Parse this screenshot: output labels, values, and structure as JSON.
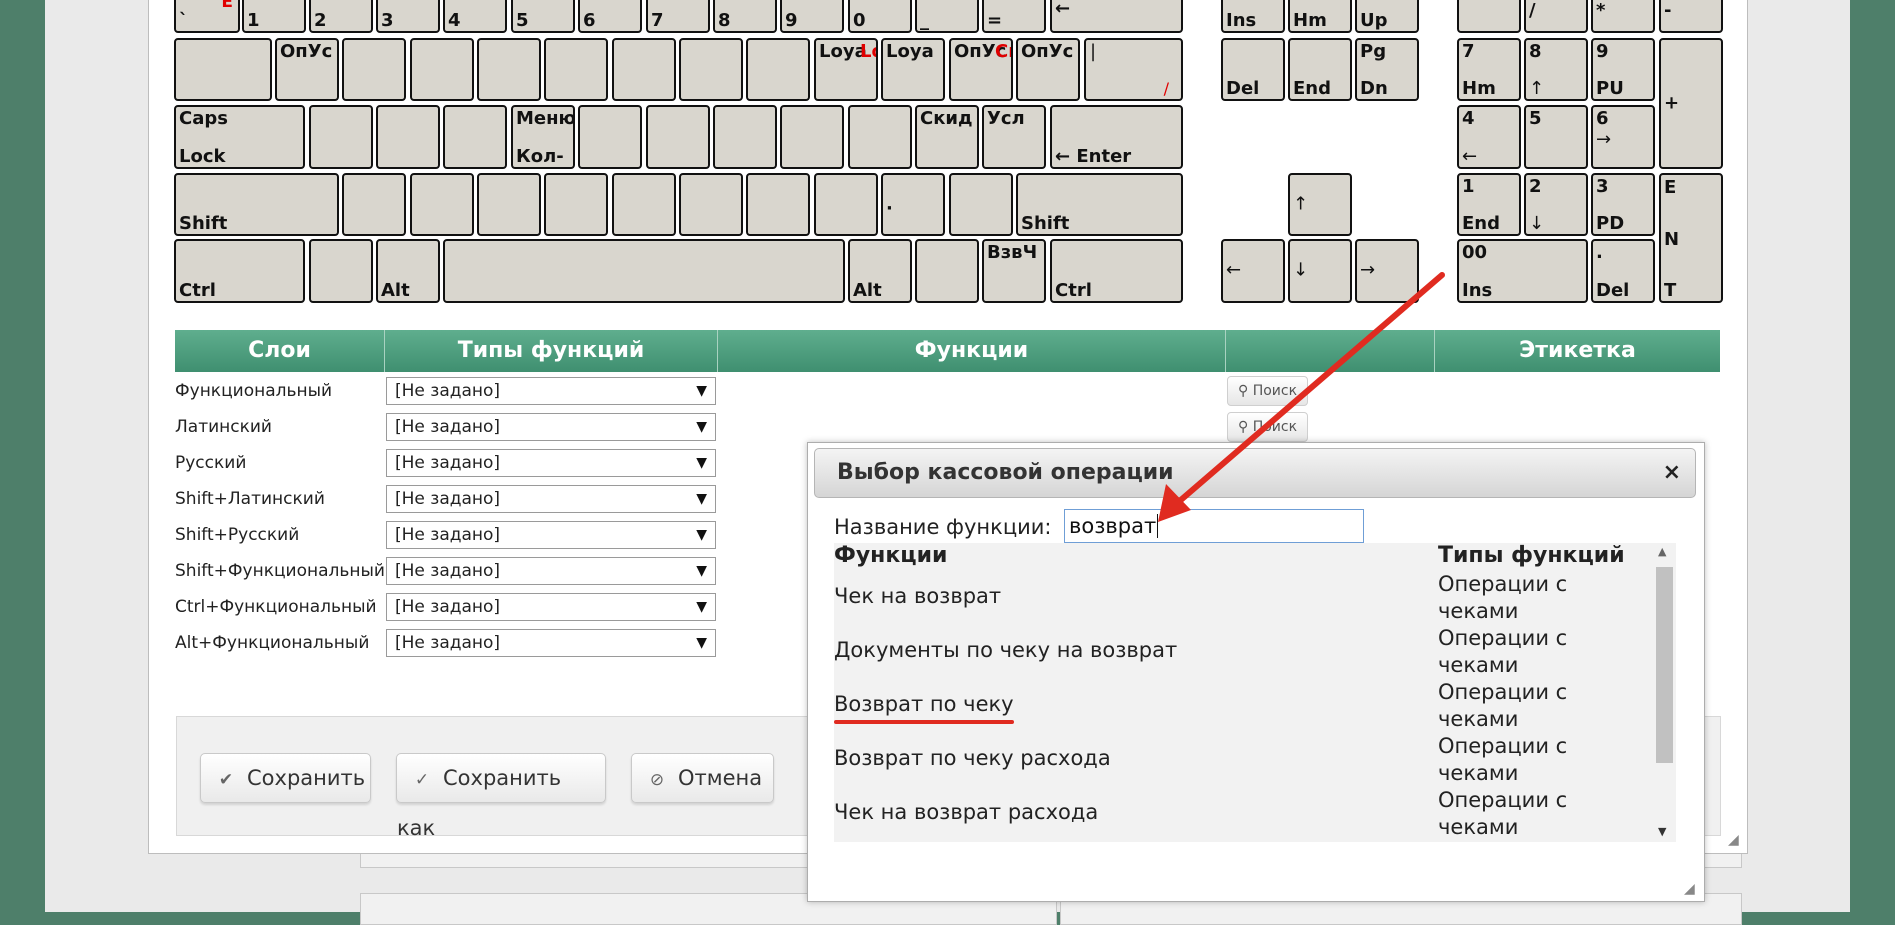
{
  "keyboard": {
    "row0": [
      "Ё",
      "1",
      "2",
      "3",
      "4",
      "5",
      "6",
      "7",
      "8",
      "9",
      "0",
      "_",
      "=",
      "←",
      "Ins",
      "Hm",
      "Up",
      "/",
      "*",
      "-"
    ],
    "row1": [
      "ОпУс",
      "Loya",
      "Lo",
      "Loya",
      "ОпУс",
      "Ск",
      "ОпУс",
      "|",
      "/",
      "Del",
      "End",
      "Pg",
      "Dn",
      "7",
      "Hm",
      "8",
      "↑",
      "9",
      "PU",
      "+"
    ],
    "row2": [
      "Caps",
      "Lock",
      "Меню",
      "Кол-",
      "Скид",
      "Усл",
      "← Enter",
      "4",
      "←",
      "5",
      "6",
      "→"
    ],
    "row3": [
      "Shift",
      ".",
      "Shift",
      "↑",
      "1",
      "End",
      "2",
      "↓",
      "3",
      "PD",
      "E",
      "N",
      "T"
    ],
    "row4": [
      "Ctrl",
      "Alt",
      "Alt",
      "ВзвЧ",
      "Ctrl",
      "←",
      "↓",
      "→",
      "00",
      "Ins",
      ".",
      "Del"
    ]
  },
  "table": {
    "headers": [
      "Слои",
      "Типы функций",
      "Функции",
      "",
      "Этикетка"
    ],
    "rows": [
      {
        "layer": "Функциональный",
        "type": "[Не задано]"
      },
      {
        "layer": "Латинский",
        "type": "[Не задано]"
      },
      {
        "layer": "Русский",
        "type": "[Не задано]"
      },
      {
        "layer": "Shift+Латинский",
        "type": "[Не задано]"
      },
      {
        "layer": "Shift+Русский",
        "type": "[Не задано]"
      },
      {
        "layer": "Shift+Функциональный",
        "type": "[Не задано]"
      },
      {
        "layer": "Ctrl+Функциональный",
        "type": "[Не задано]"
      },
      {
        "layer": "Alt+Функциональный",
        "type": "[Не задано]"
      }
    ],
    "search_label": "Поиск"
  },
  "footer": {
    "save": "Сохранить",
    "save_as": "Сохранить как",
    "cancel": "Отмена"
  },
  "dialog": {
    "title": "Выбор кассовой операции",
    "close": "×",
    "name_label": "Название функции:",
    "name_value": "возврат",
    "col_functions": "Функции",
    "col_types": "Типы функций",
    "items": [
      {
        "name": "Чек на возврат",
        "type": "Операции с чеками"
      },
      {
        "name": "Документы по чеку на возврат",
        "type": "Операции с чеками"
      },
      {
        "name": "Возврат по чеку",
        "type": "Операции с чеками"
      },
      {
        "name": "Возврат по чеку расхода",
        "type": "Операции с чеками"
      },
      {
        "name": "Чек на возврат расхода",
        "type": "Операции с чеками"
      }
    ]
  },
  "colors": {
    "header_green": "#3f8f70",
    "key_fill": "#d9d6ce",
    "annotation_red": "#e02b20"
  }
}
